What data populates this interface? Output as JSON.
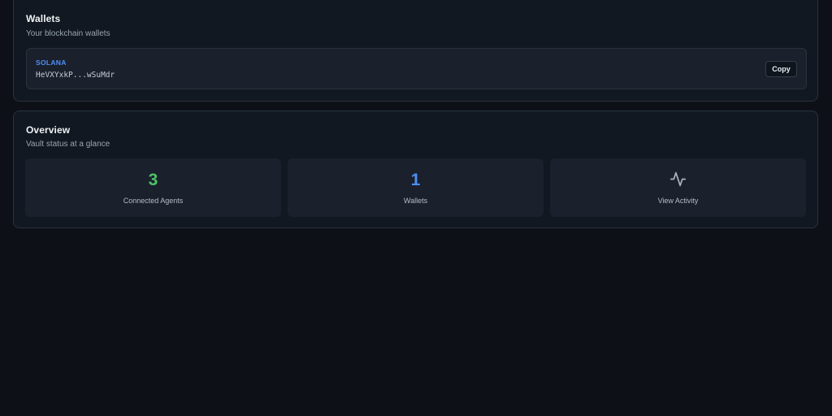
{
  "colors": {
    "background": "#0d1117",
    "card": "#111821",
    "tile": "#1a212c",
    "accent_blue": "#4f8ff7",
    "accent_green": "#4ec16a"
  },
  "wallets": {
    "title": "Wallets",
    "subtitle": "Your blockchain wallets",
    "items": [
      {
        "chain": "SOLANA",
        "address": "HeVXYxkP...wSuMdr",
        "copy_label": "Copy"
      }
    ]
  },
  "overview": {
    "title": "Overview",
    "subtitle": "Vault status at a glance",
    "stats": [
      {
        "value": "3",
        "label": "Connected Agents",
        "color": "#4ec16a"
      },
      {
        "value": "1",
        "label": "Wallets",
        "color": "#4f8ff7"
      },
      {
        "icon": "activity-icon",
        "label": "View Activity"
      }
    ]
  }
}
